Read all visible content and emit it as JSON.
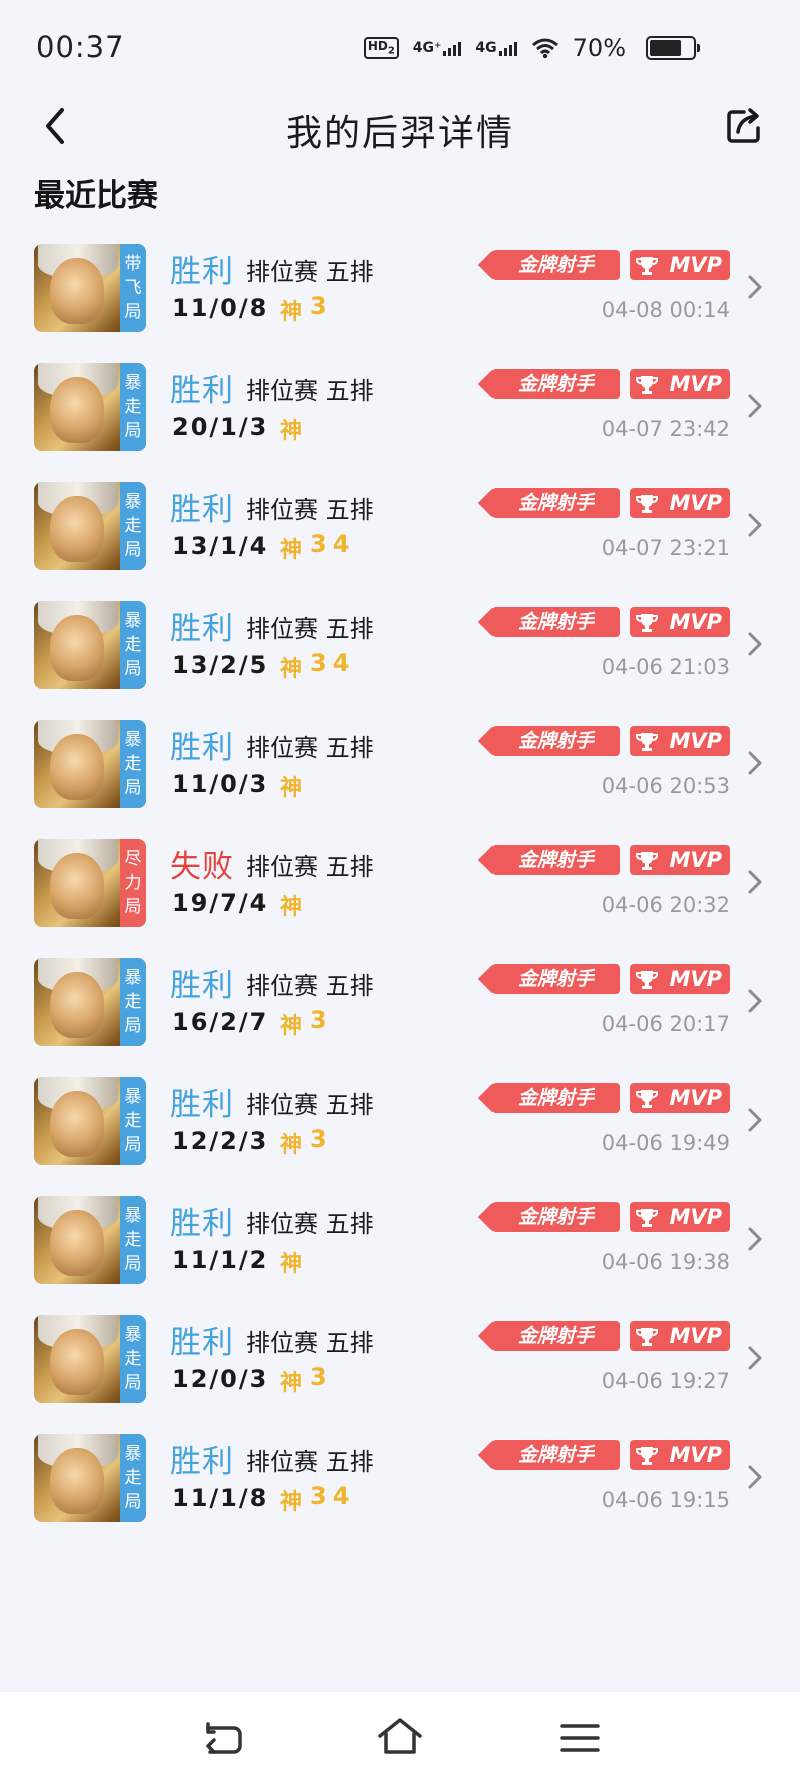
{
  "status_bar": {
    "time": "00:37",
    "hd_label": "HD",
    "hd_sub": "2",
    "net1": "4G⁺",
    "net2": "4G",
    "battery": "70%"
  },
  "header": {
    "title": "我的后羿详情"
  },
  "section_title": "最近比赛",
  "badges": {
    "gold": "金牌射手",
    "mvp": "MVP"
  },
  "matches": [
    {
      "tag": [
        "带",
        "飞",
        "局"
      ],
      "tag_color": "#4aa2df",
      "result": "胜利",
      "mode": "排位赛 五排",
      "kda": "11/0/8",
      "god": "神",
      "extra": [
        "3"
      ],
      "date": "04-08 00:14"
    },
    {
      "tag": [
        "暴",
        "走",
        "局"
      ],
      "tag_color": "#4aa2df",
      "result": "胜利",
      "mode": "排位赛 五排",
      "kda": "20/1/3",
      "god": "神",
      "extra": [],
      "date": "04-07 23:42"
    },
    {
      "tag": [
        "暴",
        "走",
        "局"
      ],
      "tag_color": "#4aa2df",
      "result": "胜利",
      "mode": "排位赛 五排",
      "kda": "13/1/4",
      "god": "神",
      "extra": [
        "3",
        "4"
      ],
      "date": "04-07 23:21"
    },
    {
      "tag": [
        "暴",
        "走",
        "局"
      ],
      "tag_color": "#4aa2df",
      "result": "胜利",
      "mode": "排位赛 五排",
      "kda": "13/2/5",
      "god": "神",
      "extra": [
        "3",
        "4"
      ],
      "date": "04-06 21:03"
    },
    {
      "tag": [
        "暴",
        "走",
        "局"
      ],
      "tag_color": "#4aa2df",
      "result": "胜利",
      "mode": "排位赛 五排",
      "kda": "11/0/3",
      "god": "神",
      "extra": [],
      "date": "04-06 20:53"
    },
    {
      "tag": [
        "尽",
        "力",
        "局"
      ],
      "tag_color": "#ec5f5b",
      "result": "失败",
      "mode": "排位赛 五排",
      "kda": "19/7/4",
      "god": "神",
      "extra": [],
      "date": "04-06 20:32"
    },
    {
      "tag": [
        "暴",
        "走",
        "局"
      ],
      "tag_color": "#4aa2df",
      "result": "胜利",
      "mode": "排位赛 五排",
      "kda": "16/2/7",
      "god": "神",
      "extra": [
        "3"
      ],
      "date": "04-06 20:17"
    },
    {
      "tag": [
        "暴",
        "走",
        "局"
      ],
      "tag_color": "#4aa2df",
      "result": "胜利",
      "mode": "排位赛 五排",
      "kda": "12/2/3",
      "god": "神",
      "extra": [
        "3"
      ],
      "date": "04-06 19:49"
    },
    {
      "tag": [
        "暴",
        "走",
        "局"
      ],
      "tag_color": "#4aa2df",
      "result": "胜利",
      "mode": "排位赛 五排",
      "kda": "11/1/2",
      "god": "神",
      "extra": [],
      "date": "04-06 19:38"
    },
    {
      "tag": [
        "暴",
        "走",
        "局"
      ],
      "tag_color": "#4aa2df",
      "result": "胜利",
      "mode": "排位赛 五排",
      "kda": "12/0/3",
      "god": "神",
      "extra": [
        "3"
      ],
      "date": "04-06 19:27"
    },
    {
      "tag": [
        "暴",
        "走",
        "局"
      ],
      "tag_color": "#4aa2df",
      "result": "胜利",
      "mode": "排位赛 五排",
      "kda": "11/1/8",
      "god": "神",
      "extra": [
        "3",
        "4"
      ],
      "date": "04-06 19:15"
    }
  ],
  "colors": {
    "win": "#45a2dd",
    "lose": "#e2443f",
    "god": "#f0b52f",
    "badge": "#ef5a5a"
  }
}
